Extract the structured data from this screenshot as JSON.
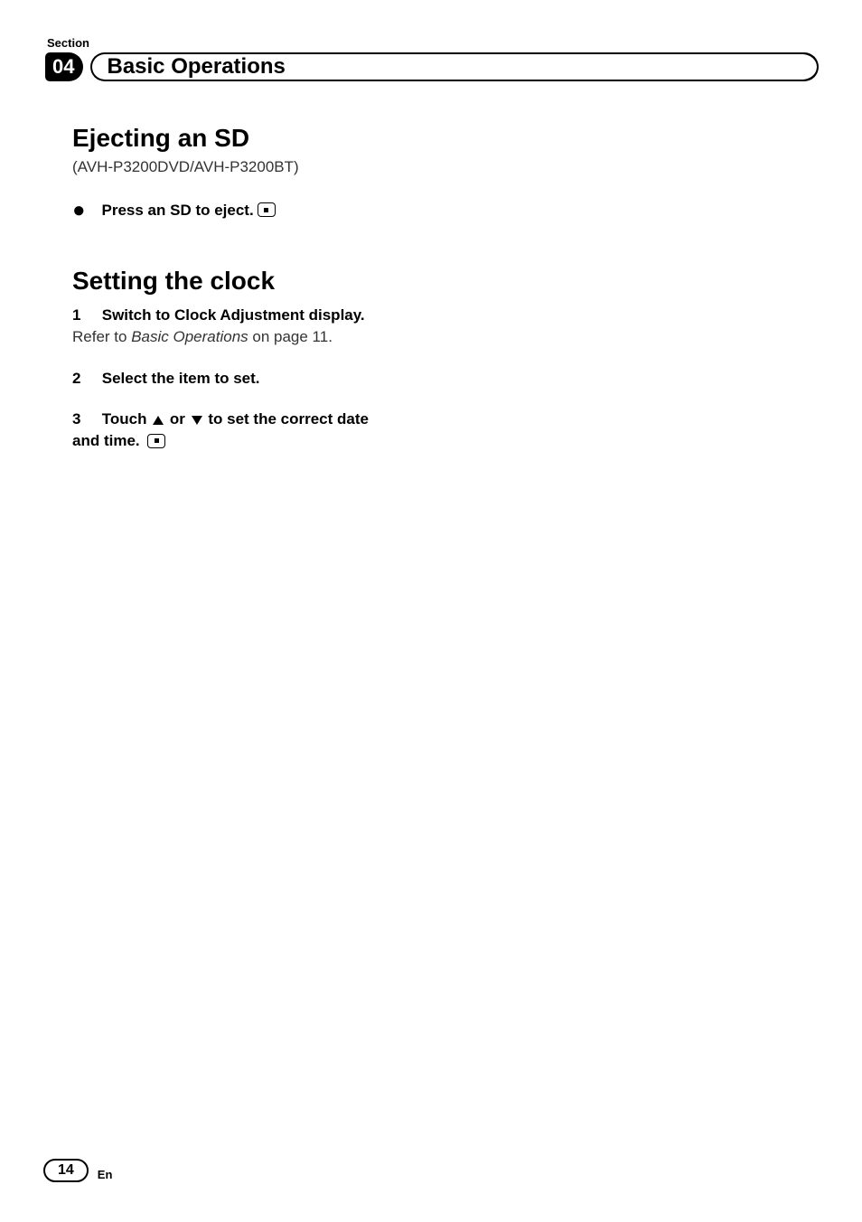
{
  "header": {
    "section_label": "Section",
    "section_number": "04",
    "title": "Basic Operations"
  },
  "sections": {
    "ejecting": {
      "title": "Ejecting an SD",
      "subtitle": "(AVH-P3200DVD/AVH-P3200BT)",
      "instruction": "Press an SD to eject."
    },
    "clock": {
      "title": "Setting the clock",
      "step1_label": "1",
      "step1_text": "Switch to Clock Adjustment display.",
      "step1_refer_prefix": "Refer to ",
      "step1_refer_italic": "Basic Operations",
      "step1_refer_suffix": " on page 11.",
      "step2_label": "2",
      "step2_text": "Select the item to set.",
      "step3_label": "3",
      "step3_prefix": "Touch ",
      "step3_mid": " or ",
      "step3_suffix": " to set the correct date",
      "step3_line2": "and time."
    }
  },
  "footer": {
    "page": "14",
    "lang": "En"
  }
}
